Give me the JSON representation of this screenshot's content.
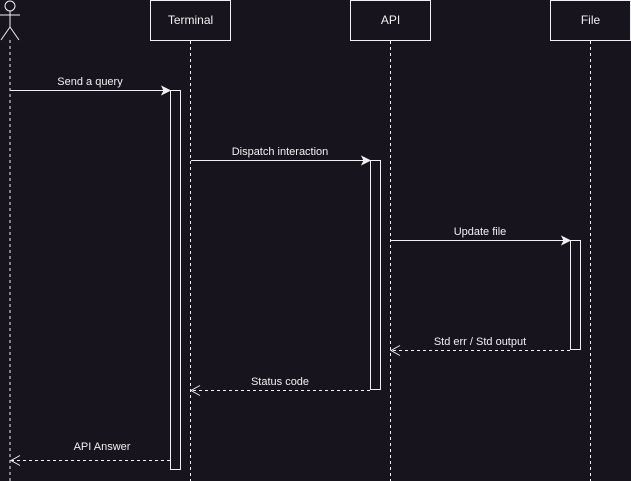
{
  "colors": {
    "background": "#18141d",
    "stroke": "#f0f0f0",
    "text": "#f0f0f0"
  },
  "actor": {
    "icon": "stick-figure-icon"
  },
  "participants": [
    {
      "id": "terminal",
      "label": "Terminal"
    },
    {
      "id": "api",
      "label": "API"
    },
    {
      "id": "file",
      "label": "File"
    }
  ],
  "messages": [
    {
      "id": "send-query",
      "label": "Send a query",
      "from": "user",
      "to": "terminal",
      "style": "solid"
    },
    {
      "id": "dispatch-interaction",
      "label": "Dispatch interaction",
      "from": "terminal",
      "to": "api",
      "style": "solid"
    },
    {
      "id": "update-file",
      "label": "Update file",
      "from": "api",
      "to": "file",
      "style": "solid"
    },
    {
      "id": "std-output",
      "label": "Std err / Std output",
      "from": "file",
      "to": "api",
      "style": "dashed"
    },
    {
      "id": "status-code",
      "label": "Status code",
      "from": "api",
      "to": "terminal",
      "style": "dashed"
    },
    {
      "id": "api-answer",
      "label": "API Answer",
      "from": "terminal",
      "to": "user",
      "style": "dashed"
    }
  ]
}
